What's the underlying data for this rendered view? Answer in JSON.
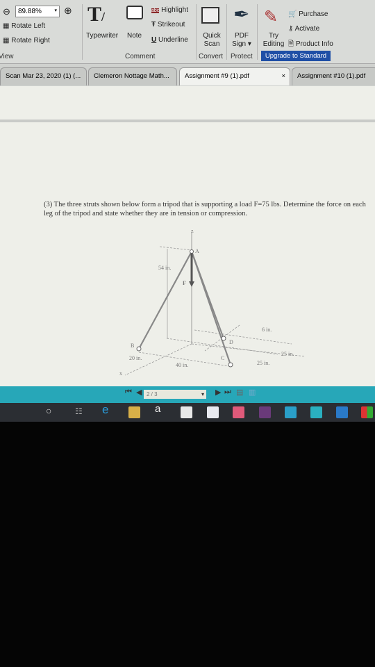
{
  "toolbar": {
    "zoom_value": "89.88%",
    "rotate_left": "Rotate Left",
    "rotate_right": "Rotate Right",
    "view_group": "View",
    "typewriter": "Typewriter",
    "note": "Note",
    "highlight": "Highlight",
    "strikeout": "Strikeout",
    "underline": "Underline",
    "comment_group": "Comment",
    "quick_scan": "Quick Scan",
    "convert_group": "Convert",
    "pdf_sign": "PDF Sign",
    "protect_group": "Protect",
    "try_editing": "Try Editing",
    "purchase": "Purchase",
    "activate": "Activate",
    "product_info": "Product Info",
    "upgrade": "Upgrade to Standard"
  },
  "tabs": [
    {
      "label": "Scan Mar 23, 2020 (1) (..."
    },
    {
      "label": "Clemeron Nottage Math..."
    },
    {
      "label": "Assignment #9 (1).pdf",
      "active": true,
      "close": "×"
    },
    {
      "label": "Assignment #10 (1).pdf"
    }
  ],
  "document": {
    "problem": "(3) The three struts shown below form a tripod that is supporting a load F=75 lbs. Determine the force on each leg of the tripod and state whether they are in tension or compression.",
    "figure": {
      "z": "z",
      "x": "x",
      "A": "A",
      "B": "B",
      "C": "C",
      "D": "D",
      "F": "F",
      "h": "54 in.",
      "d1": "6 in.",
      "d2": "25 in.",
      "d3": "25 in.",
      "d4": "20 in.",
      "d5": "40 in."
    }
  },
  "navigation": {
    "page": "2 / 3"
  },
  "taskbar": {
    "amazon": "a"
  },
  "colors": {
    "nav_bar": "#27a7b8",
    "upgrade": "#1f4fa6",
    "taskbar": "#2b2e33"
  }
}
